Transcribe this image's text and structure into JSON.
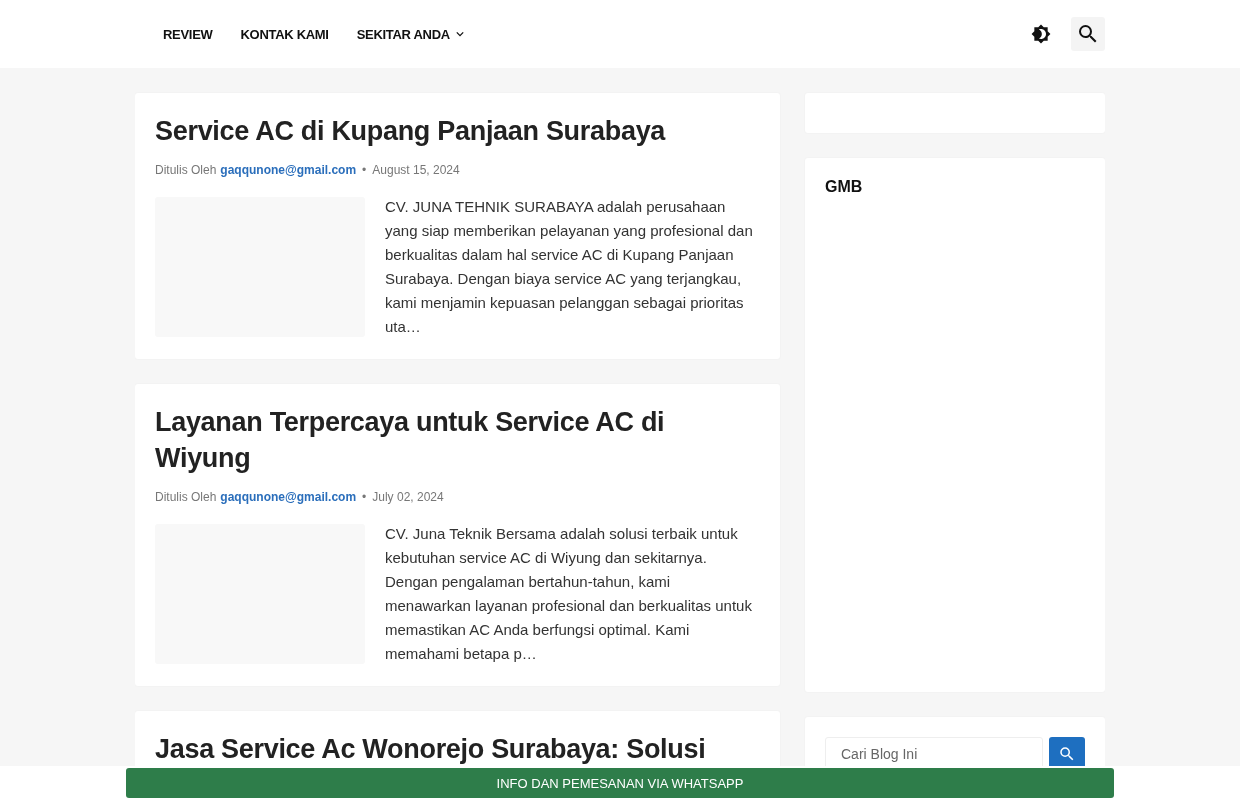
{
  "nav": {
    "items": [
      {
        "label": "REVIEW",
        "dropdown": false
      },
      {
        "label": "KONTAK KAMI",
        "dropdown": false
      },
      {
        "label": "SEKITAR ANDA",
        "dropdown": true
      }
    ]
  },
  "posts": [
    {
      "title": "Service AC di Kupang Panjaan Surabaya",
      "byline": "Ditulis Oleh",
      "author": "gaqqunone@gmail.com",
      "separator": "•",
      "date": "August 15, 2024",
      "excerpt": "CV. JUNA TEHNIK SURABAYA adalah perusahaan yang siap memberikan pelayanan yang profesional dan berkualitas dalam hal service AC di Kupang Panjaan Surabaya. Dengan biaya service AC yang terjangkau, kami menjamin kepuasan pelanggan sebagai prioritas uta…"
    },
    {
      "title": "Layanan Terpercaya untuk Service AC di Wiyung",
      "byline": "Ditulis Oleh",
      "author": "gaqqunone@gmail.com",
      "separator": "•",
      "date": "July 02, 2024",
      "excerpt": "CV. Juna Teknik Bersama adalah solusi terbaik untuk kebutuhan service AC di Wiyung dan sekitarnya. Dengan pengalaman bertahun-tahun, kami menawarkan layanan profesional dan berkualitas untuk memastikan AC Anda berfungsi optimal. Kami memahami betapa p…"
    },
    {
      "title": "Jasa Service Ac Wonorejo Surabaya: Solusi"
    }
  ],
  "sidebar": {
    "widget_title": "GMB",
    "search": {
      "placeholder": "Cari Blog Ini"
    }
  },
  "bottom_bar": {
    "label": "INFO DAN PEMESANAN VIA WHATSAPP"
  }
}
